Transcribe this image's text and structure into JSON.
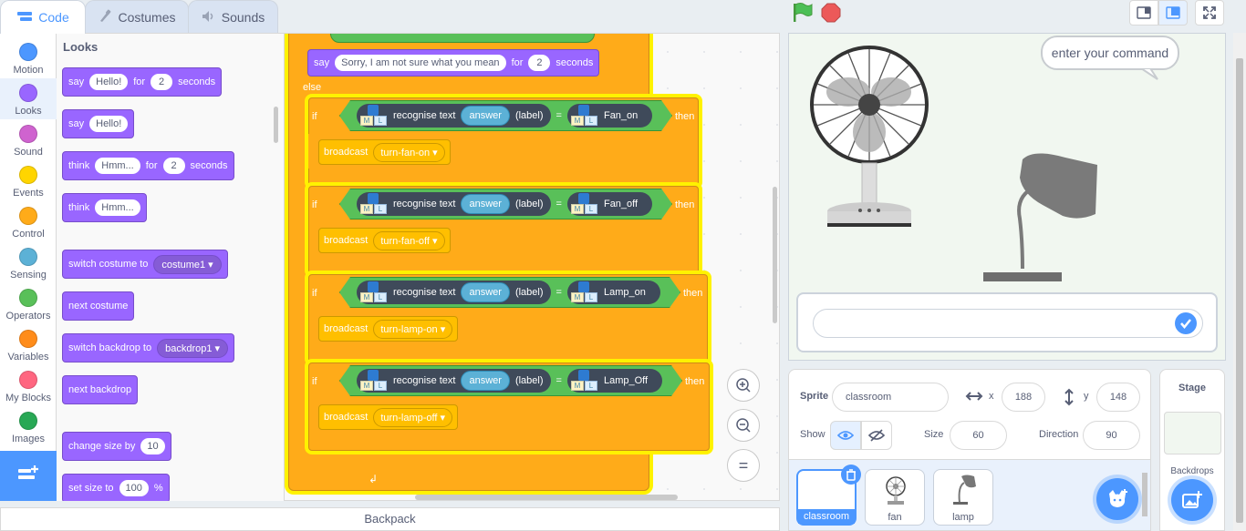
{
  "tabs": {
    "code": "Code",
    "costumes": "Costumes",
    "sounds": "Sounds"
  },
  "categories": [
    {
      "label": "Motion",
      "color": "#4c97ff"
    },
    {
      "label": "Looks",
      "color": "#9966ff"
    },
    {
      "label": "Sound",
      "color": "#cf63cf"
    },
    {
      "label": "Events",
      "color": "#ffd500"
    },
    {
      "label": "Control",
      "color": "#ffab19"
    },
    {
      "label": "Sensing",
      "color": "#5cb1d6"
    },
    {
      "label": "Operators",
      "color": "#59c059"
    },
    {
      "label": "Variables",
      "color": "#ff8c1a"
    },
    {
      "label": "My Blocks",
      "color": "#ff6680"
    },
    {
      "label": "Images",
      "color": "#28a855"
    }
  ],
  "palette": {
    "title": "Looks",
    "say_for": {
      "verb": "say",
      "msg": "Hello!",
      "for": "for",
      "secs": "2",
      "unit": "seconds"
    },
    "say": {
      "verb": "say",
      "msg": "Hello!"
    },
    "think_for": {
      "verb": "think",
      "msg": "Hmm...",
      "for": "for",
      "secs": "2",
      "unit": "seconds"
    },
    "think": {
      "verb": "think",
      "msg": "Hmm..."
    },
    "switch_costume": {
      "label": "switch costume to",
      "value": "costume1"
    },
    "next_costume": "next costume",
    "switch_backdrop": {
      "label": "switch backdrop to",
      "value": "backdrop1"
    },
    "next_backdrop": "next backdrop",
    "change_size": {
      "label": "change size by",
      "value": "10"
    },
    "set_size": {
      "label": "set size to",
      "value": "100",
      "unit": "%"
    }
  },
  "script": {
    "say": {
      "verb": "say",
      "msg": "Sorry, I am not sure what you mean",
      "for": "for",
      "secs": "2",
      "unit": "seconds"
    },
    "else": "else",
    "if": "if",
    "then": "then",
    "recognise": "recognise text",
    "answer": "answer",
    "label": "(label)",
    "eq": "=",
    "broadcast": "broadcast",
    "rows": [
      {
        "class": "Fan_on",
        "message": "turn-fan-on"
      },
      {
        "class": "Fan_off",
        "message": "turn-fan-off"
      },
      {
        "class": "Lamp_on",
        "message": "turn-lamp-on"
      },
      {
        "class": "Lamp_Off",
        "message": "turn-lamp-off"
      }
    ],
    "zoom_in": "+",
    "zoom_out": "−",
    "zoom_reset": "="
  },
  "backpack": "Backpack",
  "stage": {
    "bubble": "enter your command",
    "ask_value": ""
  },
  "sprite_info": {
    "sprite_label": "Sprite",
    "sprite_name": "classroom",
    "x_label": "x",
    "x": "188",
    "y_label": "y",
    "y": "148",
    "show_label": "Show",
    "size_label": "Size",
    "size": "60",
    "direction_label": "Direction",
    "direction": "90"
  },
  "sprites": [
    {
      "name": "classroom",
      "selected": true
    },
    {
      "name": "fan",
      "selected": false
    },
    {
      "name": "lamp",
      "selected": false
    }
  ],
  "stage_panel": {
    "title": "Stage",
    "backdrops": "Backdrops"
  },
  "icons": [
    "code-icon",
    "brush-icon",
    "speaker-icon",
    "green-flag-icon",
    "stop-icon",
    "small-stage-icon",
    "large-stage-icon",
    "fullscreen-icon",
    "extension-icon",
    "eye-icon",
    "eye-off-icon",
    "arrows-horizontal-icon",
    "arrows-vertical-icon",
    "trash-icon",
    "add-sprite-icon",
    "add-backdrop-icon",
    "check-icon"
  ]
}
